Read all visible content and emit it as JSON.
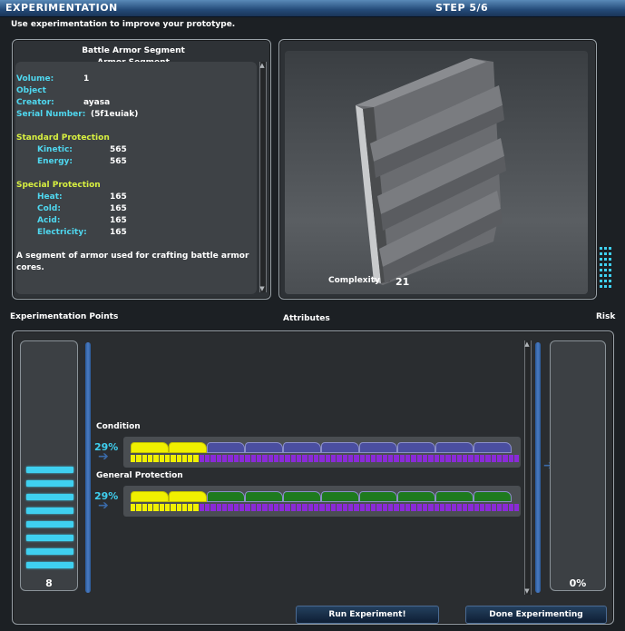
{
  "window": {
    "title": "EXPERIMENTATION",
    "step": "STEP 5/6"
  },
  "instruction": "Use experimentation to improve your prototype.",
  "item": {
    "name": "Battle Armor Segment",
    "type": "Armor Segment",
    "fields": [
      {
        "label": "Volume:",
        "value": "1"
      },
      {
        "label": "Object Creator:",
        "value": "ayasa"
      },
      {
        "label": "Serial Number:",
        "value": "(5f1euiak)"
      }
    ],
    "standard_protection": {
      "title": "Standard Protection",
      "stats": [
        {
          "label": "Kinetic:",
          "value": "565"
        },
        {
          "label": "Energy:",
          "value": "565"
        }
      ]
    },
    "special_protection": {
      "title": "Special Protection",
      "stats": [
        {
          "label": "Heat:",
          "value": "165"
        },
        {
          "label": "Cold:",
          "value": "165"
        },
        {
          "label": "Acid:",
          "value": "165"
        },
        {
          "label": "Electricity:",
          "value": "165"
        }
      ]
    },
    "description_line1": "A segment of armor used for crafting battle armor",
    "description_line2": "cores."
  },
  "preview": {
    "complexity_label": "Complexity",
    "complexity_value": "21"
  },
  "sections": {
    "exp_points_label": "Experimentation Points",
    "attributes_label": "Attributes",
    "risk_label": "Risk"
  },
  "exp_points": {
    "value": "8",
    "bars_lit": 8
  },
  "risk": {
    "value": "0%"
  },
  "attributes": [
    {
      "name": "Condition",
      "percent": "29%",
      "fill": 0.29,
      "color": "#4a4ea0"
    },
    {
      "name": "General Protection",
      "percent": "29%",
      "fill": 0.29,
      "color": "#1e7a1e"
    }
  ],
  "buttons": {
    "run": "Run Experiment!",
    "done": "Done Experimenting"
  },
  "colors": {
    "accent": "#3fd0f0",
    "label": "#4fd8f0",
    "heading": "#d8f040",
    "yellow": "#f0f000",
    "purple": "#8a2ad8"
  }
}
